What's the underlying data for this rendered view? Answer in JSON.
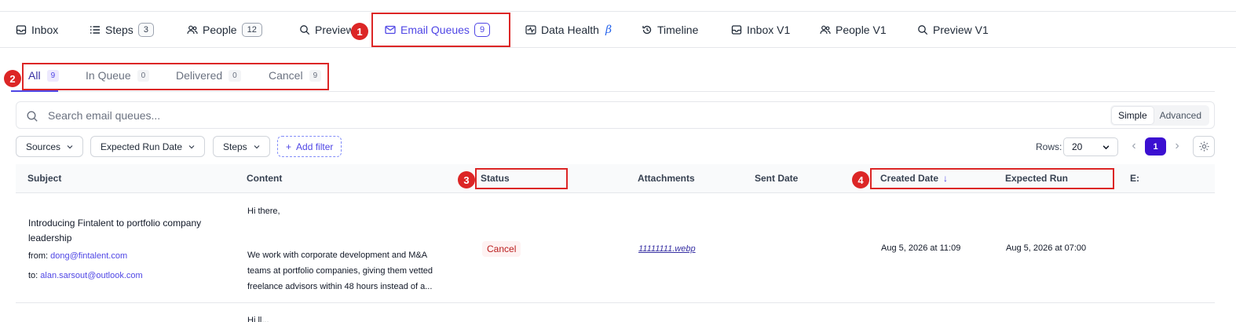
{
  "top_tabs": [
    {
      "label": "Inbox",
      "icon": "inbox-icon"
    },
    {
      "label": "Steps",
      "icon": "list-icon",
      "count": "3"
    },
    {
      "label": "People",
      "icon": "people-icon",
      "count": "12"
    },
    {
      "label": "Preview",
      "icon": "search-icon"
    },
    {
      "label": "Email Queues",
      "icon": "mail-icon",
      "count": "9",
      "active": true
    },
    {
      "label": "Data Health",
      "icon": "health-icon",
      "badge": "β"
    },
    {
      "label": "Timeline",
      "icon": "history-icon"
    },
    {
      "label": "Inbox V1",
      "icon": "inbox-icon"
    },
    {
      "label": "People V1",
      "icon": "people-icon"
    },
    {
      "label": "Preview V1",
      "icon": "search-icon"
    }
  ],
  "annotations": [
    "1",
    "2",
    "3",
    "4"
  ],
  "sub_tabs": [
    {
      "label": "All",
      "count": "9",
      "active": true
    },
    {
      "label": "In Queue",
      "count": "0"
    },
    {
      "label": "Delivered",
      "count": "0"
    },
    {
      "label": "Cancel",
      "count": "9"
    }
  ],
  "search": {
    "placeholder": "Search email queues...",
    "value": ""
  },
  "mode_toggle": {
    "simple": "Simple",
    "advanced": "Advanced",
    "selected": "Simple"
  },
  "filters": {
    "sources": "Sources",
    "expected_run_date": "Expected Run Date",
    "steps": "Steps",
    "add_filter": "Add filter"
  },
  "pagination": {
    "rows_label": "Rows:",
    "rows_value": "20",
    "current_page": "1"
  },
  "columns": {
    "subject": "Subject",
    "content": "Content",
    "status": "Status",
    "attachments": "Attachments",
    "sent_date": "Sent Date",
    "created_date": "Created Date",
    "expected_run": "Expected Run",
    "truncated": "E:"
  },
  "rows": [
    {
      "subject": "Introducing Fintalent to portfolio company leadership",
      "from_label": "from:",
      "from": "dong@fintalent.com",
      "to_label": "to:",
      "to": "alan.sarsout@outlook.com",
      "content_greeting": "Hi there,",
      "content_body": "We work with corporate development and M&A teams at portfolio companies, giving them vetted freelance advisors within 48 hours instead of a...",
      "status": "Cancel",
      "attachment": "11111111.webp",
      "sent_date": "",
      "created_date": "Aug 5, 2026 at 11:09",
      "expected_run": "Aug 5, 2026 at 07:00"
    }
  ],
  "next_row_peek": "Hi ll...",
  "colors": {
    "accent": "#4f46e5",
    "annotation": "#dc2626",
    "status_cancel": "#b91c1c"
  }
}
